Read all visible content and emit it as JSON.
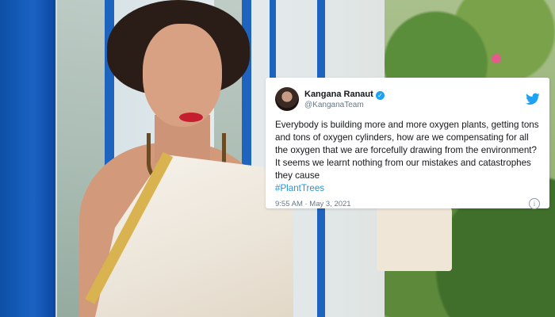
{
  "tweet": {
    "display_name": "Kangana Ranaut",
    "handle": "@KanganaTeam",
    "text": "Everybody is building more and more oxygen plants, getting tons and tons of oxygen cylinders, how are we compensating for all the oxygen that we are forcefully drawing from the environment? It seems we learnt nothing from our mistakes and catastrophes they cause",
    "hashtag": "#PlantTrees",
    "timestamp": "9:55 AM · May 3, 2021",
    "icons": {
      "verified": "verified-badge-icon",
      "brand": "twitter-bird-icon",
      "info": "info-icon"
    },
    "colors": {
      "link": "#1b95e0",
      "verified": "#1da1f2",
      "brand": "#1da1f2"
    }
  }
}
